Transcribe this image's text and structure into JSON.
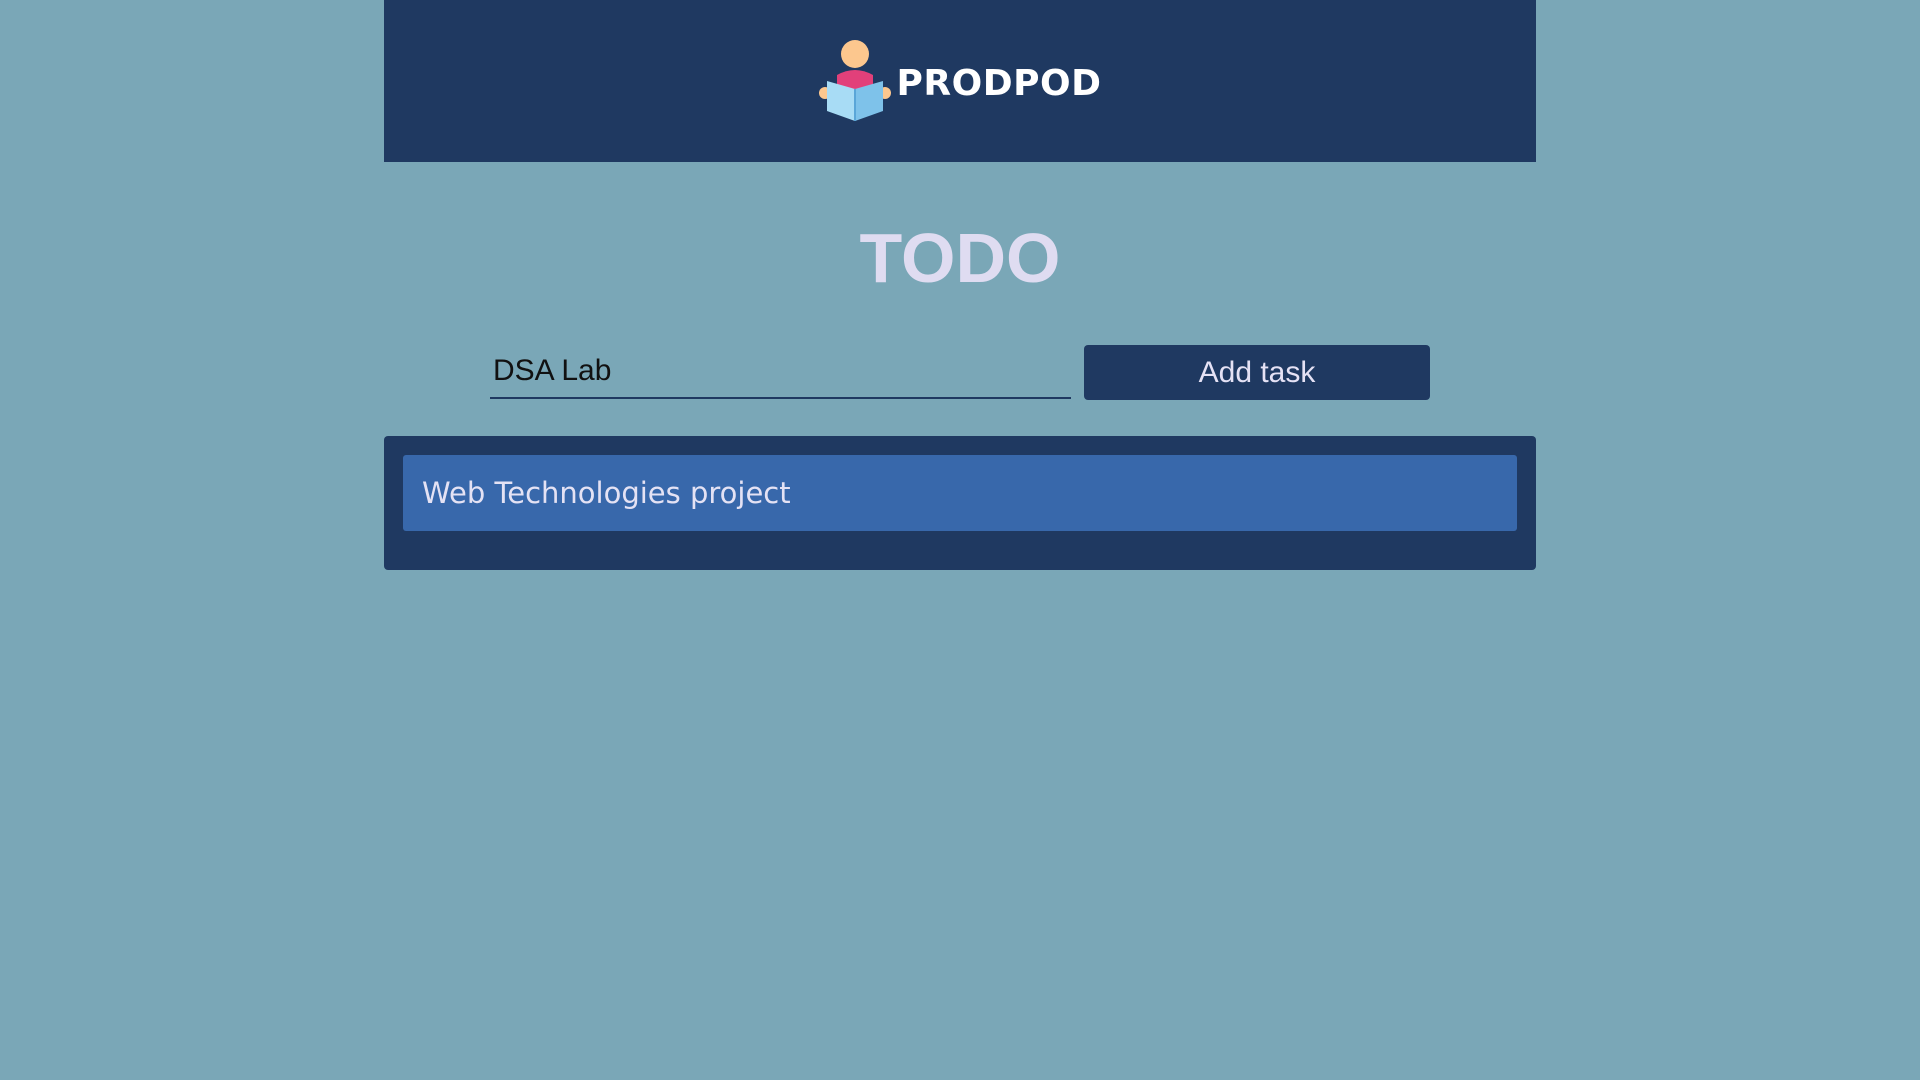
{
  "header": {
    "brand_name": "PRODPOD",
    "logo_icon": "person-reading-book-icon"
  },
  "main": {
    "title": "TODO",
    "task_input": {
      "value": "DSA Lab",
      "placeholder": ""
    },
    "add_button_label": "Add task",
    "tasks": [
      {
        "label": "Web Technologies project"
      }
    ]
  },
  "colors": {
    "background": "#7aa7b7",
    "header_bg": "#1f3961",
    "title_text": "#dfdcf1",
    "task_item_bg": "#3868ab"
  }
}
